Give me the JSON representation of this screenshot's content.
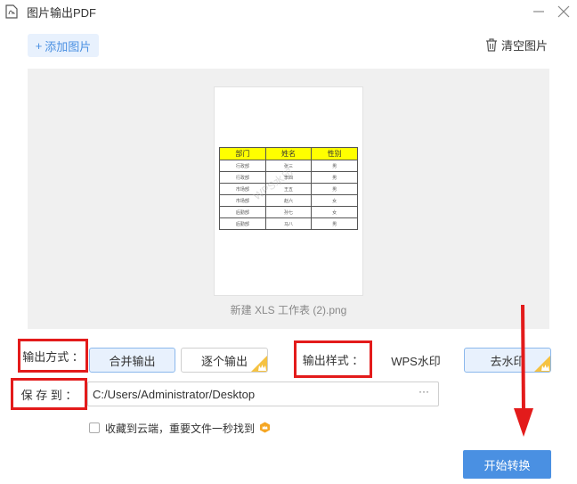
{
  "window": {
    "title": "图片输出PDF"
  },
  "toolbar": {
    "add_label": "添加图片",
    "clear_label": "清空图片"
  },
  "preview": {
    "file_name": "新建 XLS 工作表 (2).png",
    "table_headers": [
      "部门",
      "姓名",
      "性别"
    ],
    "table_rows": [
      [
        "行政部",
        "张三",
        "男"
      ],
      [
        "行政部",
        "李四",
        "男"
      ],
      [
        "市场部",
        "王五",
        "男"
      ],
      [
        "市场部",
        "赵六",
        "女"
      ],
      [
        "后勤部",
        "孙七",
        "女"
      ],
      [
        "后勤部",
        "马八",
        "男"
      ]
    ]
  },
  "output_mode": {
    "label": "输出方式 ：",
    "options": [
      "合并输出",
      "逐个输出"
    ],
    "selected": "合并输出"
  },
  "output_style": {
    "label": "输出样式 ：",
    "options": [
      "WPS水印",
      "去水印"
    ],
    "selected": "去水印"
  },
  "save": {
    "label": "保 存 到 ：",
    "path": "C:/Users/Administrator/Desktop",
    "more": "···"
  },
  "cloud": {
    "label": "收藏到云端，重要文件一秒找到",
    "checked": false
  },
  "start_button": "开始转换",
  "colors": {
    "accent": "#4a90e2",
    "highlight": "#e31b1b",
    "vip": "#f5c242",
    "table_header": "#ffff00"
  }
}
